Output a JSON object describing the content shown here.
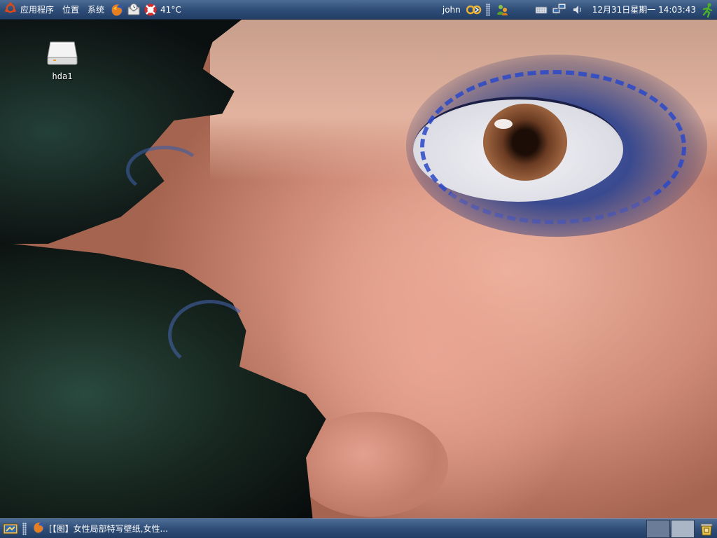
{
  "top_panel": {
    "menus": {
      "applications": "应用程序",
      "places": "位置",
      "system": "系统"
    },
    "launchers": [
      "firefox-icon",
      "mail-icon",
      "help-icon"
    ],
    "weather": {
      "temperature": "41°C"
    },
    "user": {
      "name": "john"
    },
    "clock": "12月31日星期一 14:03:43"
  },
  "desktop": {
    "icons": [
      {
        "label": "hda1",
        "icon": "drive-icon"
      }
    ]
  },
  "bottom_panel": {
    "tasks": [
      {
        "label": "[【图】女性局部特写壁纸,女性...",
        "icon": "firefox-icon"
      }
    ],
    "workspaces": [
      {
        "active": false
      },
      {
        "active": true
      }
    ]
  },
  "colors": {
    "panel_top": "#4d6c95",
    "panel_bottom": "#223e66",
    "panel_text": "#ffffff",
    "ubuntu_orange": "#dd4814"
  }
}
